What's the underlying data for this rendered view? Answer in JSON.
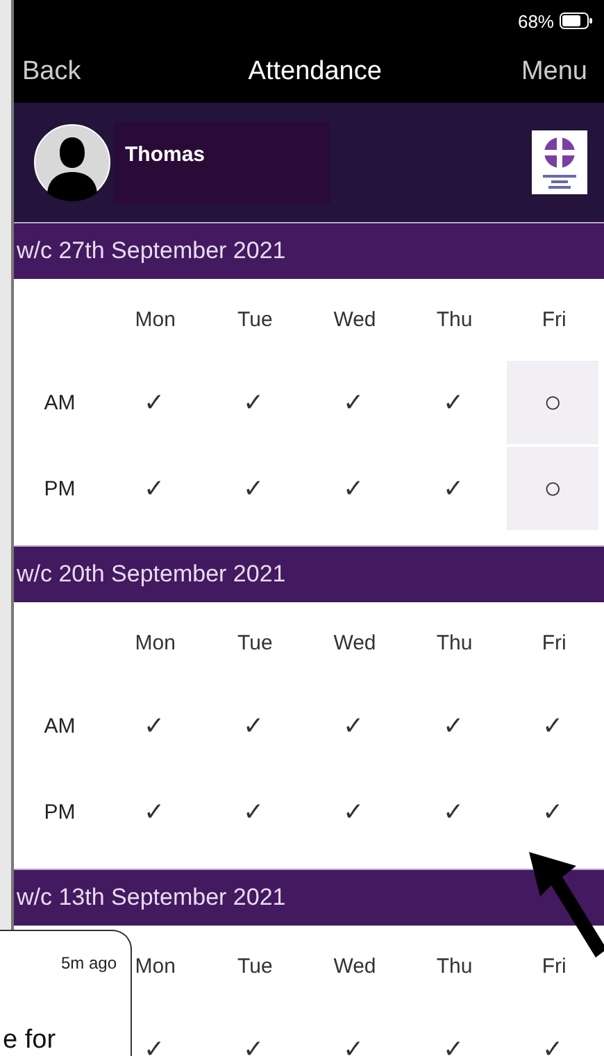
{
  "status_bar": {
    "battery": "68%"
  },
  "nav": {
    "back": "Back",
    "title": "Attendance",
    "menu": "Menu"
  },
  "profile": {
    "name": "Thomas"
  },
  "weeks": [
    {
      "title": "w/c 27th September 2021",
      "days": [
        "Mon",
        "Tue",
        "Wed",
        "Thu",
        "Fri"
      ],
      "rows": [
        {
          "label": "AM",
          "cells": [
            {
              "kind": "present",
              "mark": "✓"
            },
            {
              "kind": "present",
              "mark": "✓"
            },
            {
              "kind": "present",
              "mark": "✓"
            },
            {
              "kind": "present",
              "mark": "✓"
            },
            {
              "kind": "pending",
              "mark": "○"
            }
          ]
        },
        {
          "label": "PM",
          "cells": [
            {
              "kind": "present",
              "mark": "✓"
            },
            {
              "kind": "present",
              "mark": "✓"
            },
            {
              "kind": "present",
              "mark": "✓"
            },
            {
              "kind": "present",
              "mark": "✓"
            },
            {
              "kind": "pending",
              "mark": "○"
            }
          ]
        }
      ]
    },
    {
      "title": "w/c 20th September 2021",
      "days": [
        "Mon",
        "Tue",
        "Wed",
        "Thu",
        "Fri"
      ],
      "rows": [
        {
          "label": "AM",
          "cells": [
            {
              "kind": "present",
              "mark": "✓"
            },
            {
              "kind": "present",
              "mark": "✓"
            },
            {
              "kind": "present",
              "mark": "✓"
            },
            {
              "kind": "present",
              "mark": "✓"
            },
            {
              "kind": "present",
              "mark": "✓"
            }
          ]
        },
        {
          "label": "PM",
          "cells": [
            {
              "kind": "present",
              "mark": "✓"
            },
            {
              "kind": "present",
              "mark": "✓"
            },
            {
              "kind": "present",
              "mark": "✓"
            },
            {
              "kind": "present",
              "mark": "✓"
            },
            {
              "kind": "present",
              "mark": "✓"
            }
          ]
        }
      ]
    },
    {
      "title": "w/c 13th September 2021",
      "days": [
        "Mon",
        "Tue",
        "Wed",
        "Thu",
        "Fri"
      ],
      "rows": [
        {
          "cells": [
            {
              "kind": "present",
              "mark": "✓"
            },
            {
              "kind": "present",
              "mark": "✓"
            },
            {
              "kind": "present",
              "mark": "✓"
            },
            {
              "kind": "present",
              "mark": "✓"
            },
            {
              "kind": "present",
              "mark": "✓"
            }
          ]
        }
      ]
    }
  ],
  "notification": {
    "time": "5m ago",
    "text": "e for"
  }
}
